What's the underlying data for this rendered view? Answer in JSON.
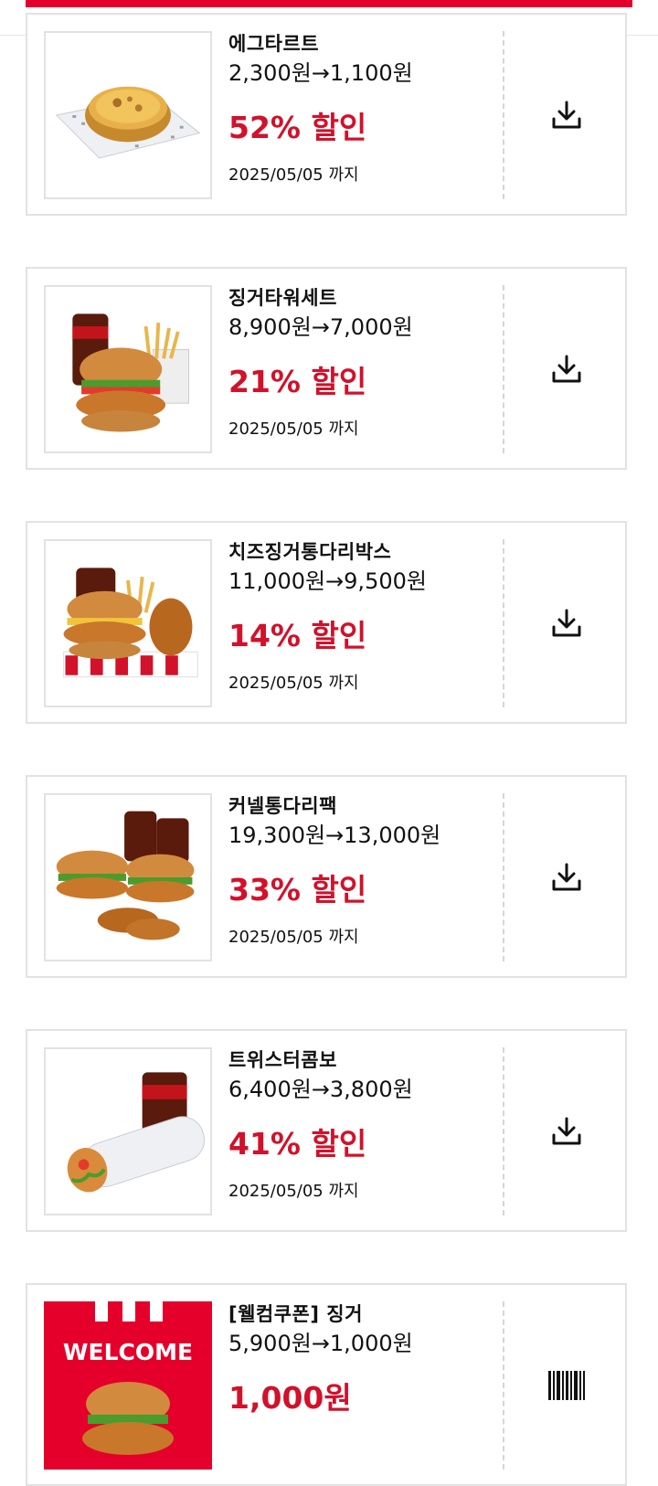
{
  "colors": {
    "accent": "#e4002b",
    "discount_text": "#d2112a",
    "border": "#e2e2e2"
  },
  "coupons": [
    {
      "name": "에그타르트",
      "price": "2,300원→1,100원",
      "discount": "52% 할인",
      "expire": "2025/05/05 까지",
      "image": "egg-tart",
      "action_icon": "download-icon"
    },
    {
      "name": "징거타워세트",
      "price": "8,900원→7,000원",
      "discount": "21% 할인",
      "expire": "2025/05/05 까지",
      "image": "zinger-tower-set",
      "action_icon": "download-icon"
    },
    {
      "name": "치즈징거통다리박스",
      "price": "11,000원→9,500원",
      "discount": "14% 할인",
      "expire": "2025/05/05 까지",
      "image": "cheese-zinger-box",
      "action_icon": "download-icon"
    },
    {
      "name": "커넬통다리팩",
      "price": "19,300원→13,000원",
      "discount": "33% 할인",
      "expire": "2025/05/05 까지",
      "image": "colonel-pack",
      "action_icon": "download-icon"
    },
    {
      "name": "트위스터콤보",
      "price": "6,400원→3,800원",
      "discount": "41% 할인",
      "expire": "2025/05/05 까지",
      "image": "twister-combo",
      "action_icon": "download-icon"
    },
    {
      "name": "[웰컴쿠폰] 징거",
      "price": "5,900원→1,000원",
      "discount": "1,000원",
      "image": "welcome-zinger",
      "image_text": "WELCOME",
      "action_icon": "barcode-icon"
    }
  ]
}
